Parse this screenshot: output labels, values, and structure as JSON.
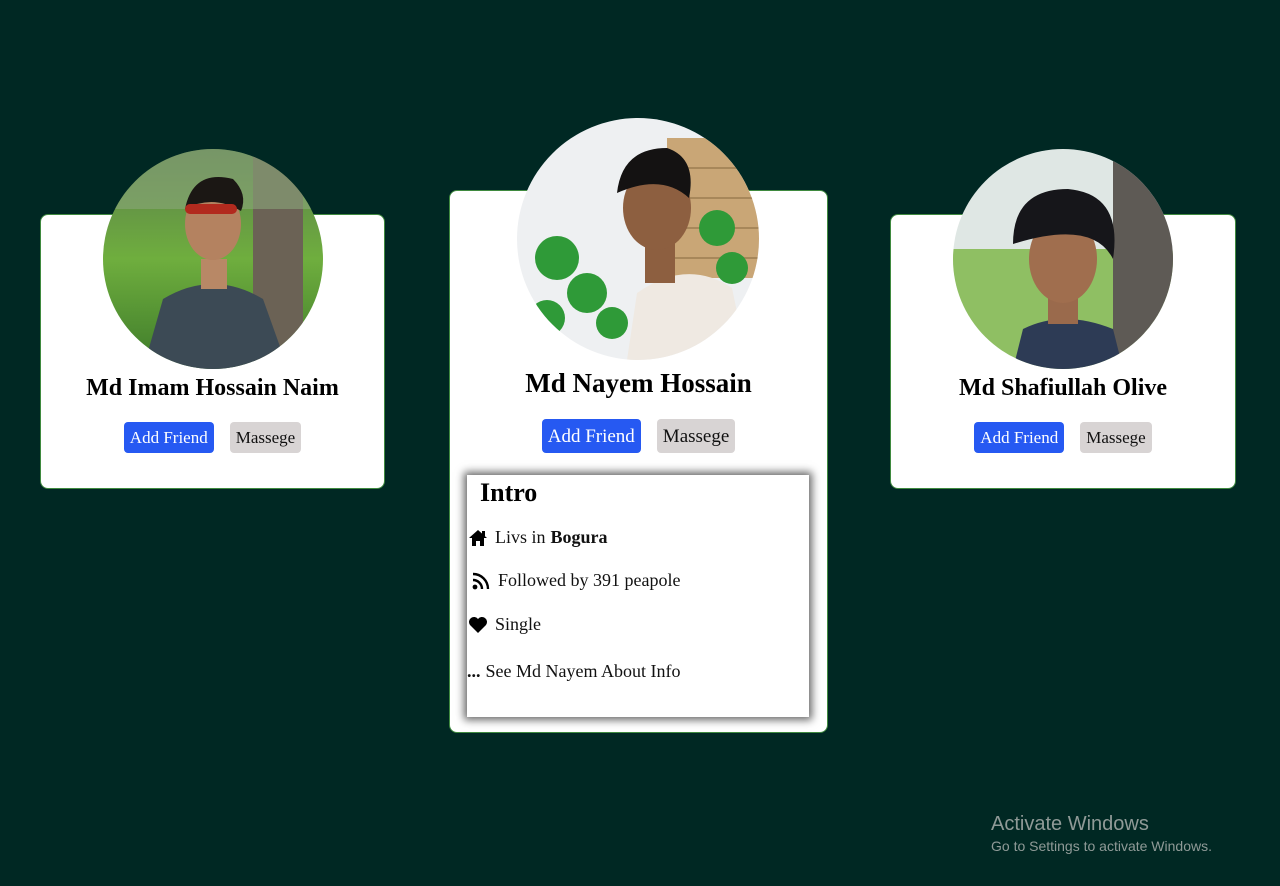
{
  "profiles": [
    {
      "name": "Md Imam Hossain Naim",
      "add_friend_label": "Add Friend",
      "message_label": "Massege",
      "avatar": "person-portrait-green-background"
    },
    {
      "name": "Md Nayem Hossain",
      "add_friend_label": "Add Friend",
      "message_label": "Massege",
      "avatar": "person-portrait-plants-wall",
      "intro": {
        "title": "Intro",
        "lives_prefix": "Livs in",
        "lives_city": "Bogura",
        "followers": "Followed by 391 peapole",
        "status": "Single",
        "see_more_dots": "...",
        "see_more_text": "See Md Nayem About Info",
        "icons": [
          "house-icon",
          "rss-icon",
          "heart-icon"
        ]
      }
    },
    {
      "name": "Md Shafiullah Olive",
      "add_friend_label": "Add Friend",
      "message_label": "Massege",
      "avatar": "person-portrait-field-background"
    }
  ],
  "watermark": {
    "title": "Activate Windows",
    "subtitle": "Go to Settings to activate Windows."
  },
  "colors": {
    "background": "#002823",
    "primary_button": "#2659f2",
    "secondary_button": "#d8d4d4",
    "card_border": "#3f8a3f"
  }
}
